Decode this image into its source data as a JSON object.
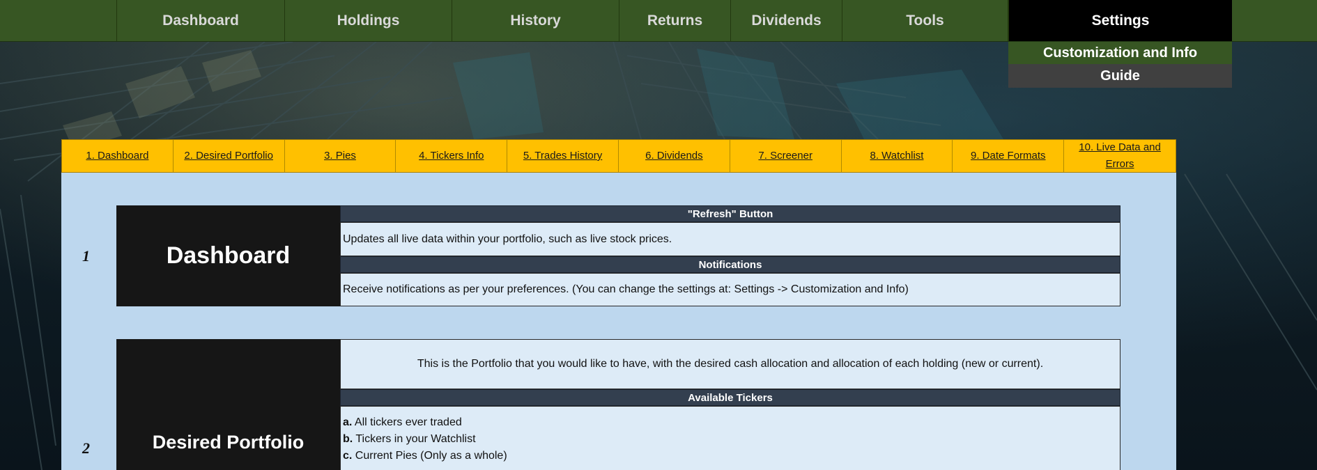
{
  "nav": {
    "items": [
      {
        "label": "Dashboard"
      },
      {
        "label": "Holdings"
      },
      {
        "label": "History"
      },
      {
        "label": "Returns"
      },
      {
        "label": "Dividends"
      },
      {
        "label": "Tools"
      },
      {
        "label": "Settings"
      }
    ],
    "active": "Settings",
    "dropdown": [
      "Customization and Info",
      "Guide"
    ]
  },
  "tabs": [
    "1. Dashboard",
    "2. Desired Portfolio",
    "3. Pies",
    "4. Tickers Info",
    "5. Trades History",
    "6. Dividends",
    "7. Screener",
    "8. Watchlist",
    "9. Date Formats",
    "10. Live Data and Errors"
  ],
  "sections": {
    "dashboard": {
      "number": "1",
      "title": "Dashboard",
      "refresh_header": "\"Refresh\" Button",
      "refresh_text": "Updates all live data within your portfolio, such as live stock prices.",
      "notifications_header": "Notifications",
      "notifications_text": "Receive notifications as per your preferences. (You can change the settings at: Settings -> Customization and Info)"
    },
    "desired_portfolio": {
      "number": "2",
      "title": "Desired Portfolio",
      "intro_text": "This is the Portfolio that you would like to have, with the desired cash allocation and allocation of each holding (new or current).",
      "tickers_header": "Available Tickers",
      "tickers_list": [
        {
          "key": "a.",
          "text": " All tickers ever traded"
        },
        {
          "key": "b.",
          "text": " Tickers in your Watchlist"
        },
        {
          "key": "c.",
          "text": " Current Pies (Only as a whole)"
        }
      ]
    }
  },
  "colors": {
    "nav_green": "#375623",
    "active_black": "#000000",
    "tab_yellow": "#ffc000",
    "panel_blue": "#bdd7ee",
    "cell_light": "#ddebf7",
    "header_slate": "#333f4f"
  }
}
